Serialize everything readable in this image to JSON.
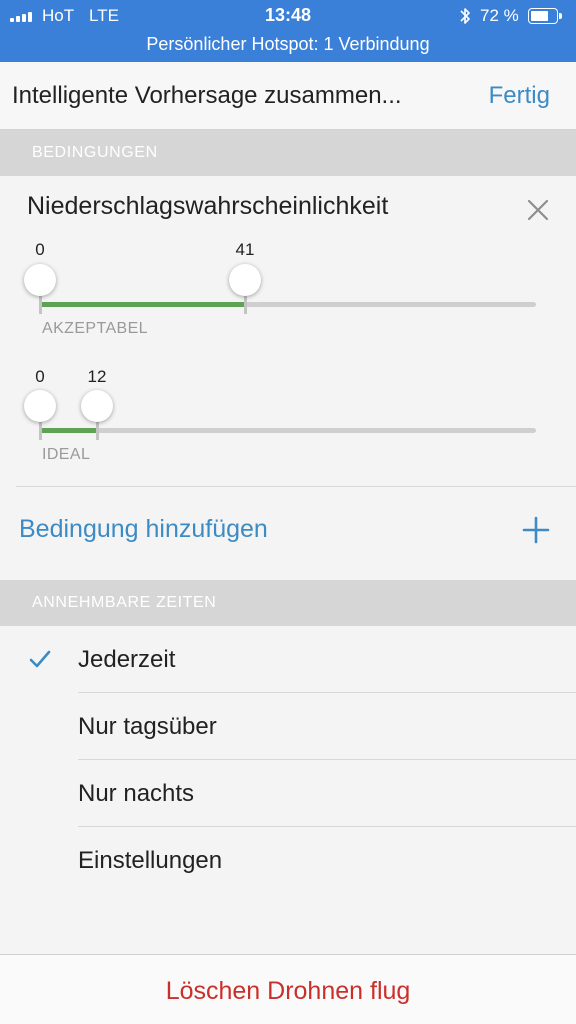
{
  "status_bar": {
    "carrier": "HoT",
    "network": "LTE",
    "time": "13:48",
    "battery_percent": "72 %",
    "battery_level": 0.72,
    "hotspot_banner": "Persönlicher Hotspot: 1 Verbindung",
    "background_color": "#3a80d8"
  },
  "nav": {
    "title": "Intelligente Vorhersage zusammen...",
    "done_label": "Fertig"
  },
  "conditions_section": {
    "header": "BEDINGUNGEN",
    "condition": {
      "title": "Niederschlagswahrscheinlichkeit",
      "close_icon": "close-icon",
      "acceptable": {
        "min": "0",
        "max": "41",
        "label": "AKZEPTABEL"
      },
      "ideal": {
        "min": "0",
        "max": "12",
        "label": "IDEAL"
      },
      "range_fill_color": "#5fa155"
    },
    "add_condition_label": "Bedingung hinzufügen",
    "add_icon": "plus-icon"
  },
  "times_section": {
    "header": "ANNEHMBARE ZEITEN",
    "options": [
      {
        "label": "Jederzeit",
        "selected": true
      },
      {
        "label": "Nur tagsüber",
        "selected": false
      },
      {
        "label": "Nur nachts",
        "selected": false
      },
      {
        "label": "Einstellungen",
        "selected": false
      }
    ]
  },
  "footer": {
    "delete_label": "Löschen Drohnen flug",
    "delete_color": "#c9302c"
  },
  "accent_color": "#3d8bc4"
}
